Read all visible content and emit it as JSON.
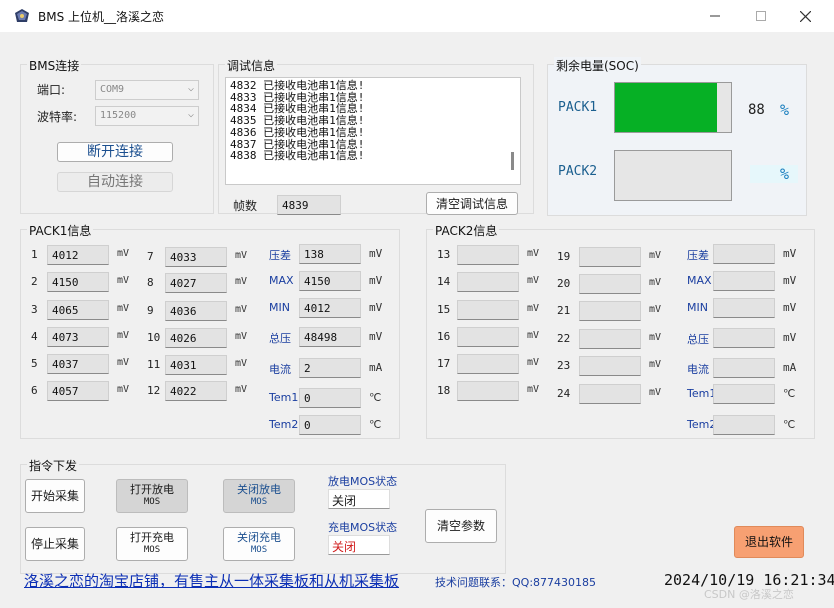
{
  "window": {
    "title": "BMS 上位机__洛溪之恋"
  },
  "conn": {
    "title": "BMS连接",
    "port_label": "端口:",
    "port_value": "COM9",
    "baud_label": "波特率:",
    "baud_value": "115200",
    "disconnect_label": "断开连接",
    "auto_label": "自动连接"
  },
  "debug": {
    "title": "调试信息",
    "lines": [
      "4832  已接收电池串1信息!",
      "4833  已接收电池串1信息!",
      "4834  已接收电池串1信息!",
      "4835  已接收电池串1信息!",
      "4836  已接收电池串1信息!",
      "4837  已接收电池串1信息!",
      "4838  已接收电池串1信息!"
    ],
    "frames_label": "帧数",
    "frames_value": "4839",
    "clear_label": "清空调试信息"
  },
  "soc": {
    "title": "剩余电量(SOC)",
    "pack1_label": "PACK1",
    "pack1_value": "88",
    "pack1_fraction": 0.88,
    "pack2_label": "PACK2",
    "pack2_value": "",
    "pct": "%",
    "fill_color": "#06b025"
  },
  "pack1": {
    "title": "PACK1信息",
    "cells": [
      {
        "n": "1",
        "v": "4012"
      },
      {
        "n": "2",
        "v": "4150"
      },
      {
        "n": "3",
        "v": "4065"
      },
      {
        "n": "4",
        "v": "4073"
      },
      {
        "n": "5",
        "v": "4037"
      },
      {
        "n": "6",
        "v": "4057"
      },
      {
        "n": "7",
        "v": "4033"
      },
      {
        "n": "8",
        "v": "4027"
      },
      {
        "n": "9",
        "v": "4036"
      },
      {
        "n": "10",
        "v": "4026"
      },
      {
        "n": "11",
        "v": "4031"
      },
      {
        "n": "12",
        "v": "4022"
      }
    ],
    "unit_mv": "mV",
    "stats": [
      {
        "label": "压差",
        "value": "138",
        "unit": "mV"
      },
      {
        "label": "MAX",
        "value": "4150",
        "unit": "mV"
      },
      {
        "label": "MIN",
        "value": "4012",
        "unit": "mV"
      },
      {
        "label": "总压",
        "value": "48498",
        "unit": "mV"
      },
      {
        "label": "电流",
        "value": "2",
        "unit": "mA"
      },
      {
        "label": "Tem1",
        "value": "0",
        "unit": "℃"
      },
      {
        "label": "Tem2",
        "value": "0",
        "unit": "℃"
      }
    ]
  },
  "pack2": {
    "title": "PACK2信息",
    "cells": [
      {
        "n": "13",
        "v": ""
      },
      {
        "n": "14",
        "v": ""
      },
      {
        "n": "15",
        "v": ""
      },
      {
        "n": "16",
        "v": ""
      },
      {
        "n": "17",
        "v": ""
      },
      {
        "n": "18",
        "v": ""
      },
      {
        "n": "19",
        "v": ""
      },
      {
        "n": "20",
        "v": ""
      },
      {
        "n": "21",
        "v": ""
      },
      {
        "n": "22",
        "v": ""
      },
      {
        "n": "23",
        "v": ""
      },
      {
        "n": "24",
        "v": ""
      }
    ],
    "unit_mv": "mV",
    "stats": [
      {
        "label": "压差",
        "value": "",
        "unit": "mV"
      },
      {
        "label": "MAX",
        "value": "",
        "unit": "mV"
      },
      {
        "label": "MIN",
        "value": "",
        "unit": "mV"
      },
      {
        "label": "总压",
        "value": "",
        "unit": "mV"
      },
      {
        "label": "电流",
        "value": "",
        "unit": "mA"
      },
      {
        "label": "Tem1",
        "value": "",
        "unit": "℃"
      },
      {
        "label": "Tem2",
        "value": "",
        "unit": "℃"
      }
    ]
  },
  "cmd": {
    "title": "指令下发",
    "start_label": "开始采集",
    "stop_label": "停止采集",
    "open_dis_1": "打开放电",
    "open_dis_2": "MOS",
    "close_dis_1": "关闭放电",
    "close_dis_2": "MOS",
    "open_chg_1": "打开充电",
    "open_chg_2": "MOS",
    "close_chg_1": "关闭充电",
    "close_chg_2": "MOS",
    "dis_status_label": "放电MOS状态",
    "dis_status_value": "关闭",
    "chg_status_label": "充电MOS状态",
    "chg_status_value": "关闭",
    "clear_params_label": "清空参数"
  },
  "exit_label": "退出软件",
  "footer": {
    "shop_link": "洛溪之恋的淘宝店铺，有售主从一体采集板和从机采集板",
    "support": "技术问题联系：QQ:877430185",
    "clock": "2024/10/19 16:21:34",
    "watermark": "CSDN @洛溪之恋"
  },
  "colors": {
    "accent_blue": "#1b7fbf",
    "exit_bg": "#f7a072",
    "status_red": "#d11d1d"
  }
}
